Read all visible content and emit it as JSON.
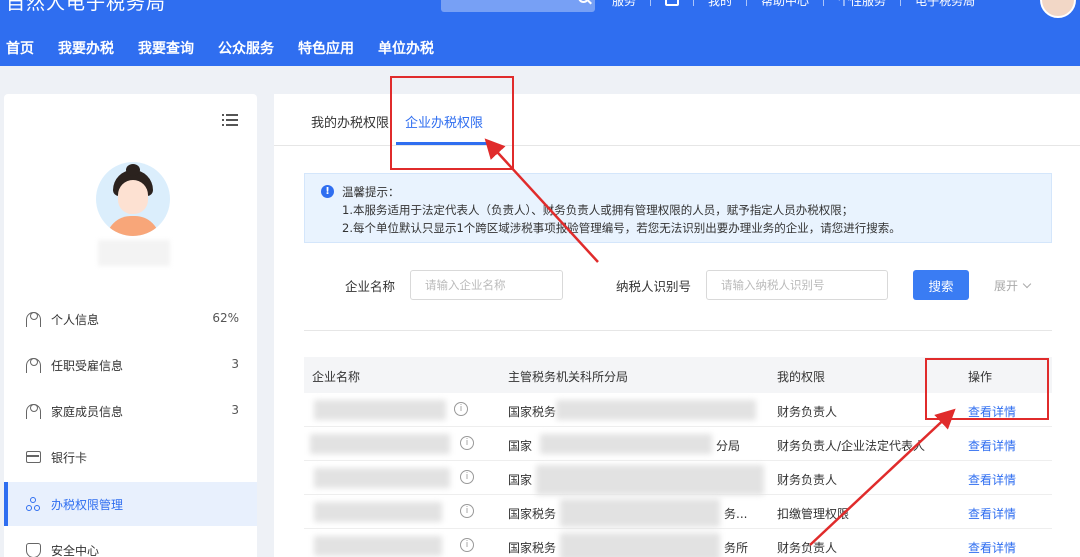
{
  "header": {
    "brand": "自然人电子税务局",
    "top_links": [
      "服务",
      "",
      "我的",
      "帮助中心",
      "个性服务",
      "电子税务局"
    ],
    "nav": [
      "首页",
      "我要办税",
      "我要查询",
      "公众服务",
      "特色应用",
      "单位办税"
    ]
  },
  "sidebar": {
    "items": [
      {
        "label": "个人信息",
        "value": "62%"
      },
      {
        "label": "任职受雇信息",
        "value": "3"
      },
      {
        "label": "家庭成员信息",
        "value": "3"
      },
      {
        "label": "银行卡",
        "value": ""
      },
      {
        "label": "办税权限管理",
        "value": ""
      },
      {
        "label": "安全中心",
        "value": ""
      }
    ]
  },
  "tabs": [
    "我的办税权限",
    "企业办税权限"
  ],
  "notice": {
    "title": "温馨提示：",
    "line1": "1.本服务适用于法定代表人（负责人）、财务负责人或拥有管理权限的人员，赋予指定人员办税权限；",
    "line2": "2.每个单位默认只显示1个跨区域涉税事项报验管理编号，若您无法识别出要办理业务的企业，请您进行搜索。"
  },
  "form": {
    "company_label": "企业名称",
    "company_placeholder": "请输入企业名称",
    "taxid_label": "纳税人识别号",
    "taxid_placeholder": "请输入纳税人识别号",
    "search": "搜索",
    "expand": "展开"
  },
  "table": {
    "headers": [
      "企业名称",
      "主管税务机关科所分局",
      "我的权限",
      "操作"
    ],
    "rows": [
      {
        "bureau": "国家税务",
        "suffix": "",
        "permission": "财务负责人",
        "action": "查看详情"
      },
      {
        "bureau": "国家",
        "suffix": "分局",
        "permission": "财务负责人/企业法定代表人",
        "action": "查看详情"
      },
      {
        "bureau": "国家",
        "suffix": "",
        "permission": "财务负责人",
        "action": "查看详情"
      },
      {
        "bureau": "国家税务",
        "suffix": "务...",
        "permission": "扣缴管理权限",
        "action": "查看详情"
      },
      {
        "bureau": "国家税务",
        "suffix": "务所",
        "permission": "财务负责人",
        "action": "查看详情"
      }
    ]
  },
  "colors": {
    "primary": "#2f6ef0",
    "annotation": "#e02b2b",
    "notice_bg": "#e9f3fe"
  }
}
